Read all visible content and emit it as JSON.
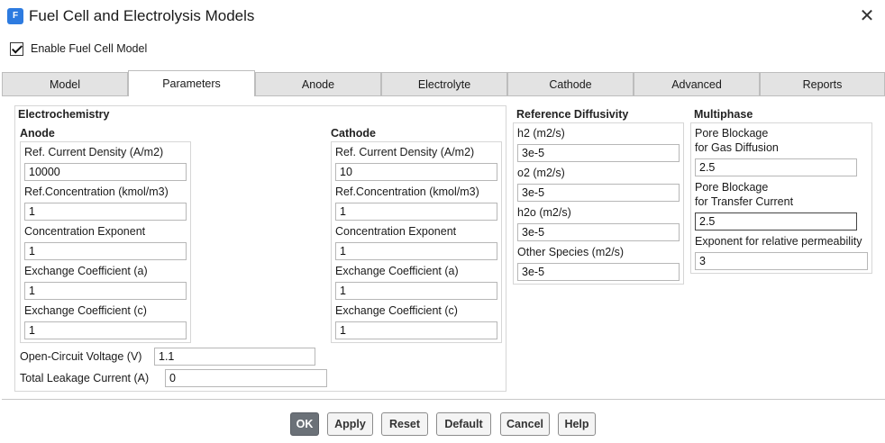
{
  "window": {
    "title": "Fuel Cell and Electrolysis Models",
    "icon_letter": "F",
    "close_glyph": "✕"
  },
  "enable": {
    "label": "Enable Fuel Cell Model",
    "checked": true
  },
  "tabs": [
    "Model",
    "Parameters",
    "Anode",
    "Electrolyte",
    "Cathode",
    "Advanced",
    "Reports"
  ],
  "active_tab": "Parameters",
  "electrochemistry": {
    "title": "Electrochemistry",
    "anode": {
      "title": "Anode",
      "ref_current_density_label": "Ref. Current Density (A/m2)",
      "ref_current_density": "10000",
      "ref_concentration_label": "Ref.Concentration  (kmol/m3)",
      "ref_concentration": "1",
      "concentration_exponent_label": "Concentration Exponent",
      "concentration_exponent": "1",
      "exchange_coeff_a_label": "Exchange Coefficient (a)",
      "exchange_coeff_a": "1",
      "exchange_coeff_c_label": "Exchange Coefficient (c)",
      "exchange_coeff_c": "1"
    },
    "cathode": {
      "title": "Cathode",
      "ref_current_density_label": "Ref. Current Density (A/m2)",
      "ref_current_density": "10",
      "ref_concentration_label": "Ref.Concentration  (kmol/m3)",
      "ref_concentration": "1",
      "concentration_exponent_label": "Concentration Exponent",
      "concentration_exponent": "1",
      "exchange_coeff_a_label": "Exchange Coefficient (a)",
      "exchange_coeff_a": "1",
      "exchange_coeff_c_label": "Exchange Coefficient (c)",
      "exchange_coeff_c": "1"
    },
    "open_circuit_voltage_label": "Open-Circuit  Voltage (V)",
    "open_circuit_voltage": "1.1",
    "total_leakage_current_label": "Total  Leakage  Current (A)",
    "total_leakage_current": "0"
  },
  "reference_diffusivity": {
    "title": "Reference Diffusivity",
    "h2_label": "h2  (m2/s)",
    "h2": "3e-5",
    "o2_label": "o2  (m2/s)",
    "o2": "3e-5",
    "h2o_label": "h2o (m2/s)",
    "h2o": "3e-5",
    "other_label": "Other Species (m2/s)",
    "other": "3e-5"
  },
  "multiphase": {
    "title": "Multiphase",
    "pore_gas_label_1": "Pore Blockage",
    "pore_gas_label_2": "for Gas Diffusion",
    "pore_gas": "2.5",
    "pore_transfer_label_1": "Pore Blockage",
    "pore_transfer_label_2": "for Transfer Current",
    "pore_transfer": "2.5",
    "exponent_label": "Exponent for relative permeability",
    "exponent": "3"
  },
  "buttons": {
    "ok": "OK",
    "apply": "Apply",
    "reset": "Reset",
    "default": "Default",
    "cancel": "Cancel",
    "help": "Help"
  }
}
